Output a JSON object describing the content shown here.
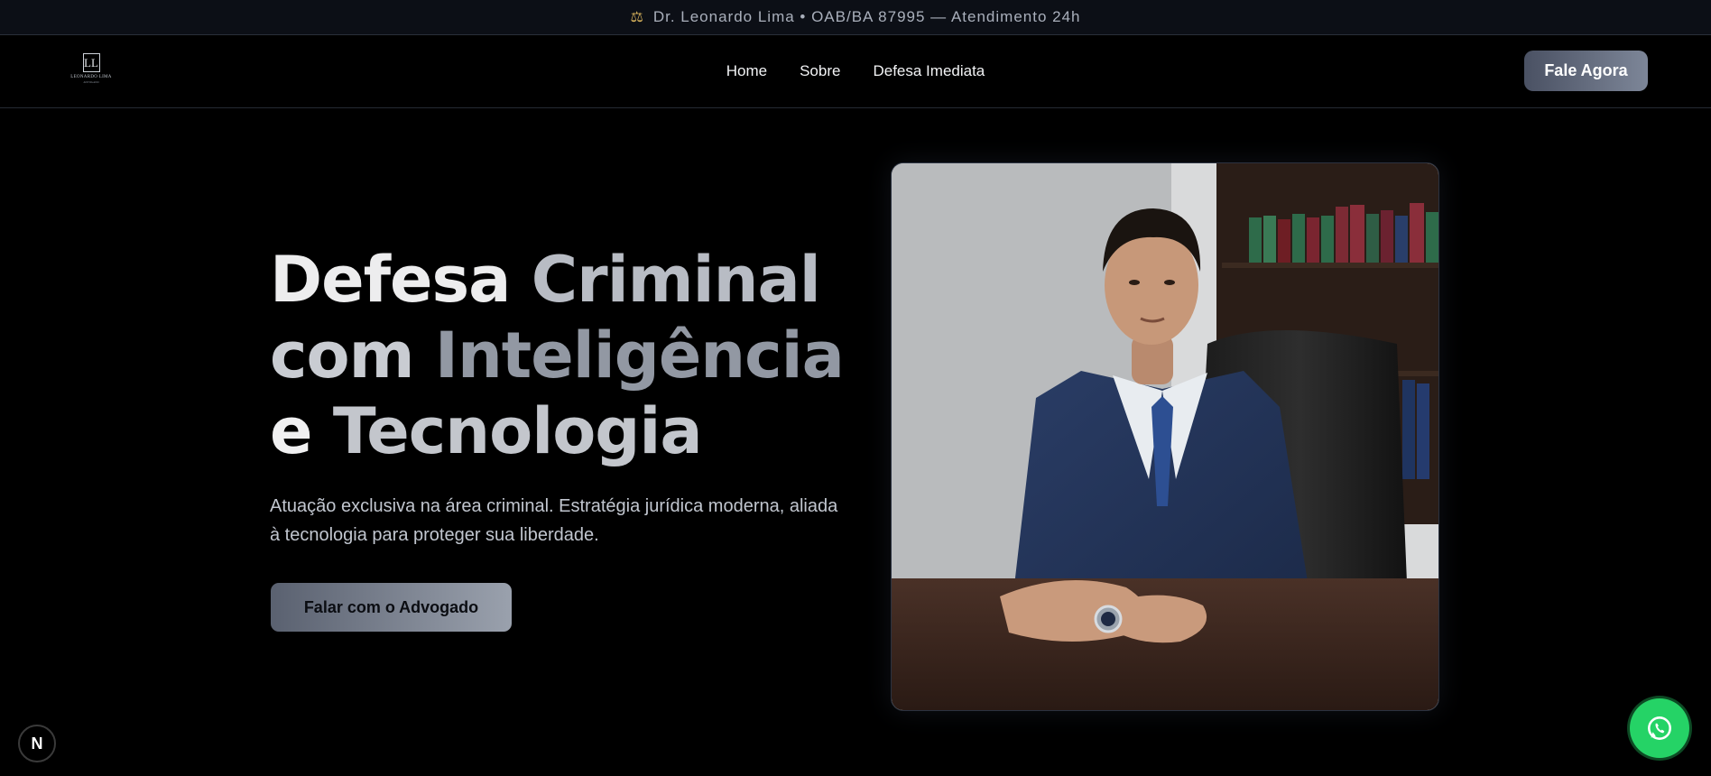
{
  "topbar": {
    "icon": "scale-icon",
    "text": "Dr. Leonardo Lima • OAB/BA 87995 — Atendimento 24h"
  },
  "nav": {
    "logo_monogram": "LL",
    "logo_name": "LEONARDO LIMA",
    "logo_sub": "ADVOGADO",
    "items": [
      {
        "label": "Home"
      },
      {
        "label": "Sobre"
      },
      {
        "label": "Defesa Imediata"
      }
    ],
    "cta_label": "Fale Agora"
  },
  "hero": {
    "headline": {
      "line1": [
        "Defesa",
        "Criminal"
      ],
      "line2": [
        "com",
        "Inteligência"
      ],
      "line3": [
        "e",
        "Tecnologia"
      ]
    },
    "subtitle": "Atuação exclusiva na área criminal. Estratégia jurídica moderna, aliada à tecnologia para proteger sua liberdade.",
    "cta_label": "Falar com o Advogado",
    "photo_alt": "Dr. Leonardo Lima"
  },
  "floating": {
    "nextjs_label": "N",
    "whatsapp_icon": "whatsapp-icon"
  },
  "colors": {
    "background": "#000000",
    "topbar_bg": "#0c0f16",
    "accent_gradient_start": "#4a5163",
    "accent_gradient_end": "#9aa1ad",
    "whatsapp": "#25d366"
  }
}
